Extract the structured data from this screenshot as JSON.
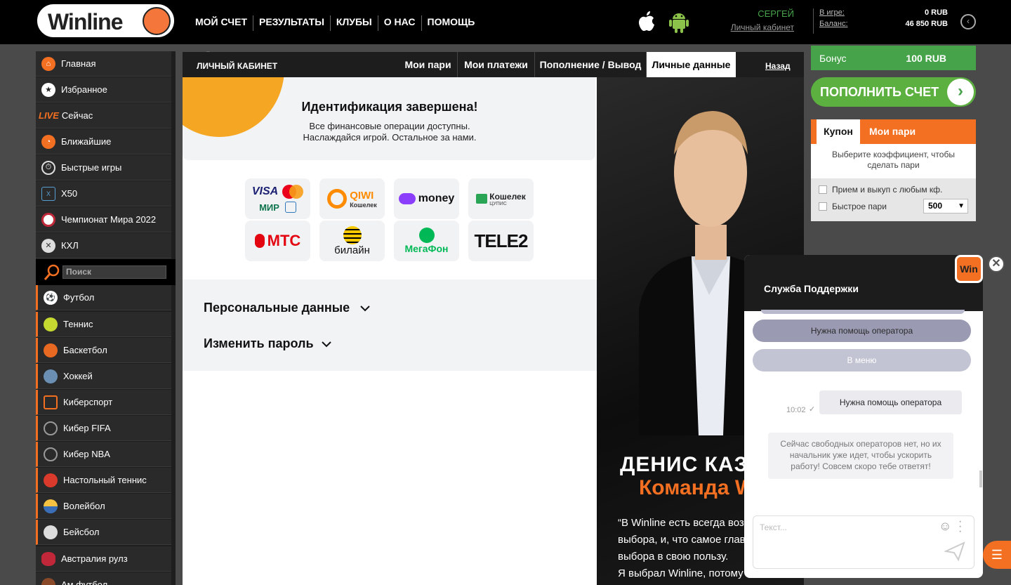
{
  "header": {
    "logo_text": "Winline",
    "nav": [
      "МОЙ СЧЕТ",
      "РЕЗУЛЬТАТЫ",
      "КЛУБЫ",
      "О НАС",
      "ПОМОЩЬ"
    ],
    "user_name": "СЕРГЕЙ",
    "cabinet_link": "Личный кабинет",
    "in_game_label": "В игре:",
    "in_game_value": "0 RUB",
    "balance_label": "Баланс:",
    "balance_value": "46 850 RUB"
  },
  "sidebar": {
    "items": [
      {
        "label": "Главная",
        "icon": "home-icon"
      },
      {
        "label": "Избранное",
        "icon": "star-icon"
      },
      {
        "label": "Сейчас",
        "icon": "live-icon",
        "badge": "LIVE"
      },
      {
        "label": "Ближайшие",
        "icon": "clock-icon"
      },
      {
        "label": "Быстрые игры",
        "icon": "stopwatch-icon"
      },
      {
        "label": "X50",
        "icon": "x50-icon"
      },
      {
        "label": "Чемпионат Мира 2022",
        "icon": "worldcup-icon"
      },
      {
        "label": "КХЛ",
        "icon": "khl-icon"
      }
    ],
    "search_placeholder": "Поиск",
    "sports": [
      {
        "label": "Футбол",
        "icon": "football-icon"
      },
      {
        "label": "Теннис",
        "icon": "tennis-icon"
      },
      {
        "label": "Баскетбол",
        "icon": "basketball-icon"
      },
      {
        "label": "Хоккей",
        "icon": "hockey-icon"
      },
      {
        "label": "Киберспорт",
        "icon": "esports-icon"
      },
      {
        "label": "Кибер FIFA",
        "icon": "cyber-fifa-icon"
      },
      {
        "label": "Кибер NBA",
        "icon": "cyber-nba-icon"
      },
      {
        "label": "Настольный теннис",
        "icon": "table-tennis-icon"
      },
      {
        "label": "Волейбол",
        "icon": "volleyball-icon"
      },
      {
        "label": "Бейсбол",
        "icon": "baseball-icon"
      },
      {
        "label": "Австралия рулз",
        "icon": "aussie-rules-icon"
      },
      {
        "label": "Ам.футбол",
        "icon": "american-football-icon"
      }
    ]
  },
  "cabinet": {
    "title": "ЛИЧНЫЙ КАБИНЕТ",
    "tabs": [
      "Мои пари",
      "Мои платежи",
      "Пополнение / Вывод",
      "Личные данные"
    ],
    "active_tab": "Личные данные",
    "back": "Назад",
    "ident_title": "Идентификация завершена!",
    "ident_line1": "Все финансовые операции доступны.",
    "ident_line2": "Наслаждайся игрой. Остальное за нами.",
    "payments": {
      "visa": "VISA",
      "mir": "МИР",
      "qiwi": "QIWI",
      "qiwi_sub": "Кошелек",
      "yoomoney": "money",
      "koshelek": "Кошелек",
      "koshelek_sub": "ЦУПИС",
      "mts": "МТС",
      "beeline": "билайн",
      "megafon": "МегаФон",
      "tele2": "TELE2"
    },
    "personal_data": "Персональные данные",
    "change_password": "Изменить пароль"
  },
  "promo": {
    "name": "ДЕНИС КАЗАНО",
    "team": "Команда Wi",
    "quote_lines": [
      "“В Winline есть всегда возм",
      "выбора, и, что самое главно",
      "выбора в свою пользу.",
      "Я выбрал Winline, потому что"
    ]
  },
  "right": {
    "bonus_label": "Бонус",
    "bonus_value": "100 RUB",
    "deposit": "ПОПОЛНИТЬ СЧЕТ",
    "coupon_tab": "Купон",
    "my_bets_tab": "Мои пари",
    "coupon_hint": "Выберите коэффициент, чтобы сделать пари",
    "accept_any": "Прием и выкуп с любым кф.",
    "fast_bet": "Быстрое пари",
    "fast_bet_amount": "500"
  },
  "chat": {
    "title": "Служба Поддержки",
    "badge": "Win",
    "operator_btn": "Нужна помощь оператора",
    "menu_btn": "В меню",
    "user_msg": "Нужна помощь оператора",
    "time": "10:02",
    "bot_msg": "Сейчас свободных операторов нет, но их начальник уже идет, чтобы ускорить работу! Совсем скоро тебе ответят!",
    "input_placeholder": "Текст..."
  },
  "colors": {
    "accent": "#f36f21",
    "green": "#47a34a",
    "header_bg": "#000000"
  }
}
